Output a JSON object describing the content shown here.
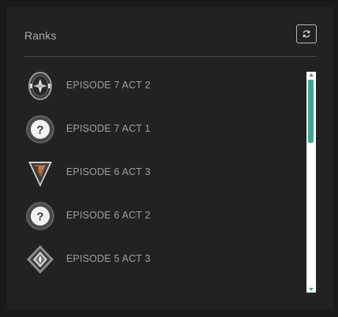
{
  "panel": {
    "title": "Ranks",
    "refresh_icon": "refresh-icon"
  },
  "ranks": [
    {
      "label": "EPISODE 7 ACT 2",
      "icon": "rank-badge-icon"
    },
    {
      "label": "EPISODE 7 ACT 1",
      "icon": "unknown-rank-icon"
    },
    {
      "label": "EPISODE 6 ACT 3",
      "icon": "triangle-rank-badge-icon"
    },
    {
      "label": "EPISODE 6 ACT 2",
      "icon": "unknown-rank-icon"
    },
    {
      "label": "EPISODE 5 ACT 3",
      "icon": "diamond-rank-badge-icon"
    }
  ],
  "colors": {
    "background": "#1a1a1a",
    "panel": "#232222",
    "scroll_thumb": "#3aa88e",
    "label_text": "#9e9e9e"
  }
}
